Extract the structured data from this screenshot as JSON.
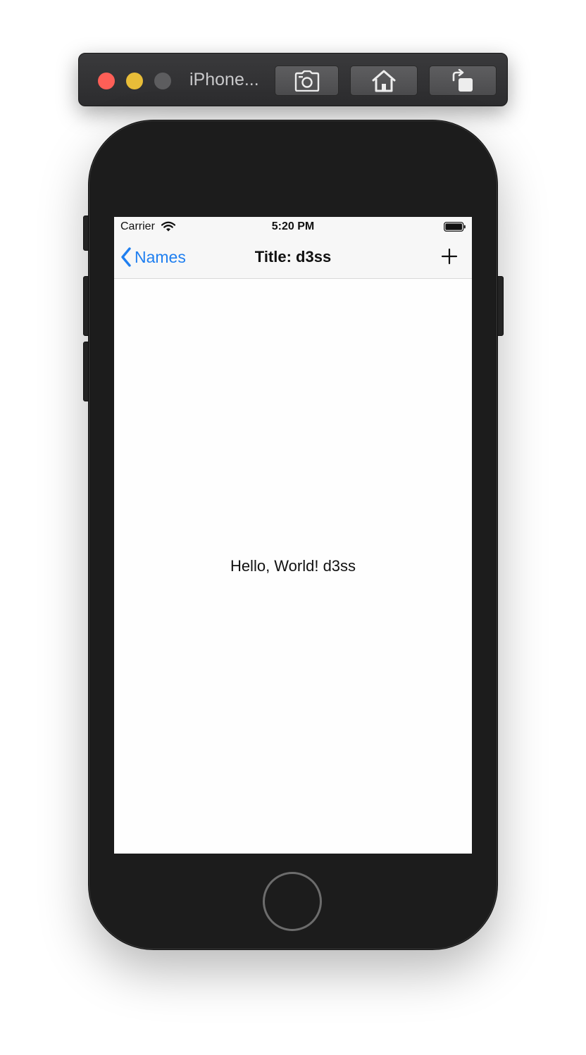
{
  "simulator": {
    "window_title": "iPhone...",
    "icons": {
      "close": "close-dot",
      "minimize": "minimize-dot",
      "zoom": "zoom-dot",
      "screenshot": "camera-icon",
      "home": "home-icon",
      "rotate": "rotate-icon"
    },
    "colors": {
      "close": "#ff5f57",
      "minimize": "#e8bd38",
      "zoom": "#5d5d5f"
    }
  },
  "status_bar": {
    "carrier": "Carrier",
    "time": "5:20 PM"
  },
  "nav_bar": {
    "back_label": "Names",
    "title": "Title: d3ss",
    "add_icon": "plus-icon"
  },
  "content": {
    "text": "Hello, World! d3ss"
  },
  "colors": {
    "accent": "#1f7ff0",
    "bar_background": "#f7f7f7",
    "device_body": "#1c1c1c"
  }
}
